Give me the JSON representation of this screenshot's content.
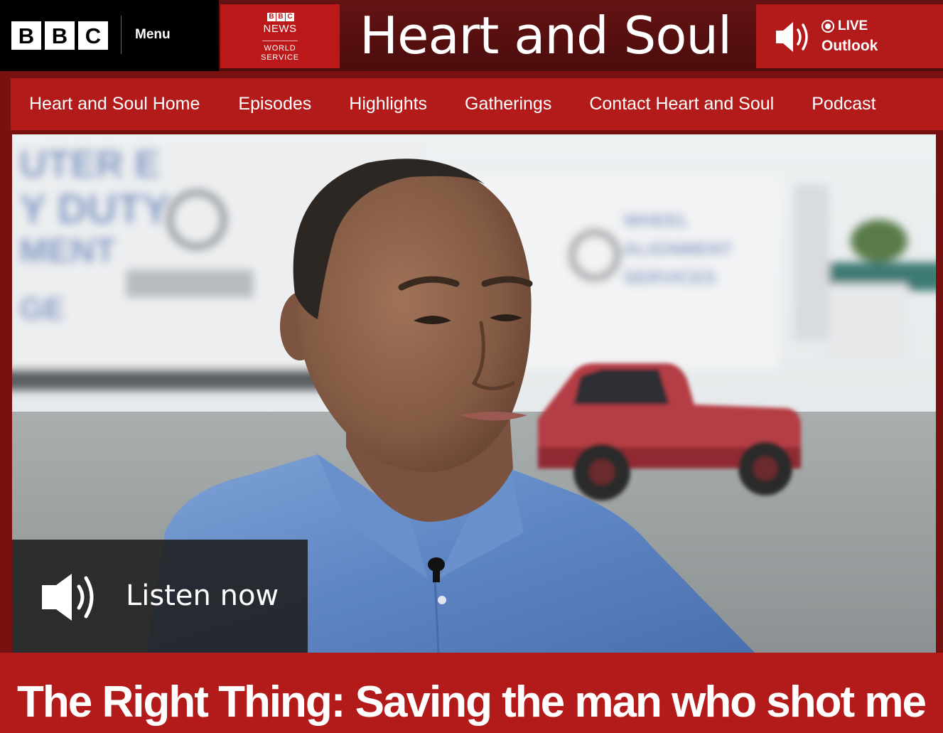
{
  "header": {
    "bbc_letters": [
      "B",
      "B",
      "C"
    ],
    "menu_label": "Menu",
    "brand": {
      "mini_letters": [
        "B",
        "B",
        "C"
      ],
      "news": "NEWS",
      "world": "WORLD",
      "service": "SERVICE"
    },
    "programme_title": "Heart and Soul",
    "live": {
      "badge": "LIVE",
      "station": "Outlook",
      "icon": "speaker-icon"
    }
  },
  "nav": {
    "items": [
      {
        "label": "Heart and Soul Home"
      },
      {
        "label": "Episodes"
      },
      {
        "label": "Highlights"
      },
      {
        "label": "Gatherings"
      },
      {
        "label": "Contact Heart and Soul"
      },
      {
        "label": "Podcast"
      }
    ]
  },
  "hero": {
    "listen_label": "Listen now",
    "listen_icon": "speaker-icon"
  },
  "episode": {
    "title": "The Right Thing: Saving the man who shot me"
  },
  "colors": {
    "brand_red": "#b31b1b",
    "masthead_dark": "#5a0f0f",
    "bbc_black": "#000000",
    "overlay": "#1e1e1e"
  }
}
